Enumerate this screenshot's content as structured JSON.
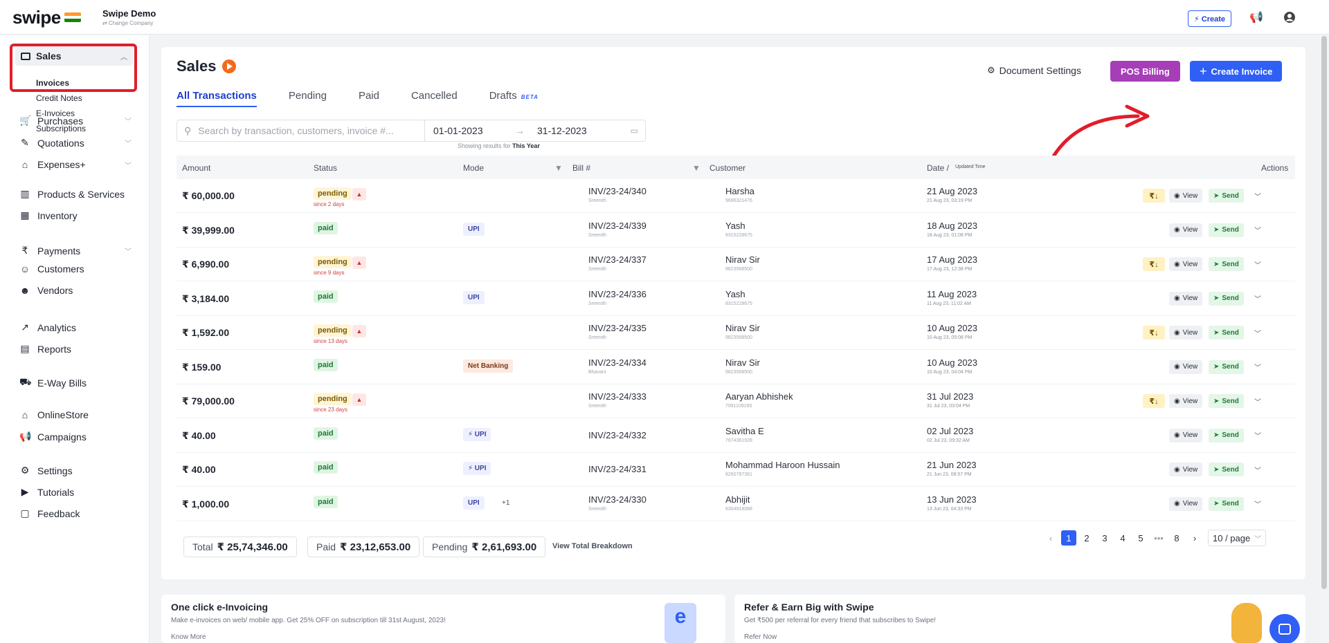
{
  "brand": {
    "logo": "swipe",
    "company_name": "Swipe Demo",
    "change_company": "⇄ Change Company"
  },
  "topbar": {
    "create_label": "⚡ Create"
  },
  "sidebar": {
    "sales_label": "Sales",
    "sales_sub": [
      "Invoices",
      "Credit Notes",
      "E-Invoices",
      "Subscriptions"
    ],
    "items": [
      {
        "label": "Purchases",
        "icon": "cart-icon",
        "chev": true
      },
      {
        "label": "Quotations",
        "icon": "pen-icon",
        "chev": true
      },
      {
        "label": "Expenses+",
        "icon": "tag-icon",
        "chev": true
      },
      {
        "label": "Products & Services",
        "icon": "barcode-icon",
        "chev": false
      },
      {
        "label": "Inventory",
        "icon": "warehouse-icon",
        "chev": false
      },
      {
        "label": "Payments",
        "icon": "rupee-icon",
        "chev": true
      },
      {
        "label": "Customers",
        "icon": "user-icon",
        "chev": false
      },
      {
        "label": "Vendors",
        "icon": "users-icon",
        "chev": false
      },
      {
        "label": "Analytics",
        "icon": "chart-icon",
        "chev": false
      },
      {
        "label": "Reports",
        "icon": "report-icon",
        "chev": false
      },
      {
        "label": "E-Way Bills",
        "icon": "truck-icon",
        "chev": false
      },
      {
        "label": "OnlineStore",
        "icon": "store-icon",
        "chev": false
      },
      {
        "label": "Campaigns",
        "icon": "megaphone-icon",
        "chev": false
      },
      {
        "label": "Settings",
        "icon": "gear-icon",
        "chev": false
      },
      {
        "label": "Tutorials",
        "icon": "youtube-icon",
        "chev": false
      },
      {
        "label": "Feedback",
        "icon": "message-icon",
        "chev": false
      }
    ]
  },
  "main": {
    "title": "Sales",
    "tabs": [
      "All Transactions",
      "Pending",
      "Paid",
      "Cancelled",
      "Drafts"
    ],
    "beta": "BETA",
    "doc_settings": "Document Settings",
    "pos_billing": "POS Billing",
    "create_invoice": "Create Invoice",
    "search_placeholder": "Search by transaction, customers, invoice #...",
    "date_from": "01-01-2023",
    "date_to": "31-12-2023",
    "showing_prefix": "Showing results for",
    "showing_period": "This Year",
    "columns": [
      "Amount",
      "Status",
      "Mode",
      "Bill #",
      "Customer",
      "Date /",
      "Updated Time",
      "Actions"
    ],
    "view_label": "View",
    "send_label": "Send",
    "rupee_down": "₹↓",
    "rows": [
      {
        "amount": "₹ 60,000.00",
        "status": "pending",
        "since": "since 2 days",
        "mode": "",
        "bill": "INV/23-24/340",
        "bill_sub": "Sreenith",
        "customer": "Harsha",
        "cust_sub": "9696321476",
        "date": "21 Aug 2023",
        "date_sub": "21 Aug 23, 03:19 PM"
      },
      {
        "amount": "₹ 39,999.00",
        "status": "paid",
        "since": "",
        "mode": "UPI",
        "bill": "INV/23-24/339",
        "bill_sub": "Sreenith",
        "customer": "Yash",
        "cust_sub": "8315228675",
        "date": "18 Aug 2023",
        "date_sub": "18 Aug 23, 01:08 PM"
      },
      {
        "amount": "₹ 6,990.00",
        "status": "pending",
        "since": "since 9 days",
        "mode": "",
        "bill": "INV/23-24/337",
        "bill_sub": "Sreenith",
        "customer": "Nirav Sir",
        "cust_sub": "9823568500",
        "date": "17 Aug 2023",
        "date_sub": "17 Aug 23, 12:38 PM"
      },
      {
        "amount": "₹ 3,184.00",
        "status": "paid",
        "since": "",
        "mode": "UPI",
        "bill": "INV/23-24/336",
        "bill_sub": "Sreenith",
        "customer": "Yash",
        "cust_sub": "8315228675",
        "date": "11 Aug 2023",
        "date_sub": "11 Aug 23, 11:02 AM"
      },
      {
        "amount": "₹ 1,592.00",
        "status": "pending",
        "since": "since 13 days",
        "mode": "",
        "bill": "INV/23-24/335",
        "bill_sub": "Sreenith",
        "customer": "Nirav Sir",
        "cust_sub": "9823568500",
        "date": "10 Aug 2023",
        "date_sub": "10 Aug 23, 05:08 PM"
      },
      {
        "amount": "₹ 159.00",
        "status": "paid",
        "since": "",
        "mode": "Net Banking",
        "bill": "INV/23-24/334",
        "bill_sub": "Bhavani",
        "customer": "Nirav Sir",
        "cust_sub": "9823568500",
        "date": "10 Aug 2023",
        "date_sub": "10 Aug 23, 04:04 PM"
      },
      {
        "amount": "₹ 79,000.00",
        "status": "pending",
        "since": "since 23 days",
        "mode": "",
        "bill": "INV/23-24/333",
        "bill_sub": "Sreenith",
        "customer": "Aaryan Abhishek",
        "cust_sub": "7091109165",
        "date": "31 Jul 2023",
        "date_sub": "31 Jul 23, 03:04 PM"
      },
      {
        "amount": "₹ 40.00",
        "status": "paid",
        "since": "",
        "mode": "⚡ UPI",
        "bill": "INV/23-24/332",
        "bill_sub": "",
        "customer": "Savitha E",
        "cust_sub": "7674361928",
        "date": "02 Jul 2023",
        "date_sub": "02 Jul 23, 09:32 AM"
      },
      {
        "amount": "₹ 40.00",
        "status": "paid",
        "since": "",
        "mode": "⚡ UPI",
        "bill": "INV/23-24/331",
        "bill_sub": "",
        "customer": "Mohammad Haroon Hussain",
        "cust_sub": "8260787361",
        "date": "21 Jun 2023",
        "date_sub": "21 Jun 23, 08:57 PM"
      },
      {
        "amount": "₹ 1,000.00",
        "status": "paid",
        "since": "",
        "mode": "UPI",
        "mode_extra": "+1",
        "bill": "INV/23-24/330",
        "bill_sub": "Sreenith",
        "customer": "Abhijit",
        "cust_sub": "6304918088",
        "date": "13 Jun 2023",
        "date_sub": "13 Jun 23, 04:33 PM"
      }
    ],
    "totals": {
      "total_label": "Total",
      "total_value": "₹ 25,74,346.00",
      "paid_label": "Paid",
      "paid_value": "₹ 23,12,653.00",
      "pending_label": "Pending",
      "pending_value": "₹ 2,61,693.00",
      "breakdown": "View Total Breakdown"
    },
    "pagination": {
      "pages": [
        "1",
        "2",
        "3",
        "4",
        "5",
        "•••",
        "8"
      ],
      "page_size": "10 / page"
    }
  },
  "promos": [
    {
      "title": "One click e-Invoicing",
      "text": "Make e-invoices on web/ mobile app. Get 25% OFF on subscription till 31st August, 2023!",
      "link": "Know More"
    },
    {
      "title": "Refer & Earn Big with Swipe",
      "text": "Get ₹500 per referral for every friend that subscribes to Swipe!",
      "link": "Refer Now"
    }
  ],
  "colors": {
    "accent": "#2f5ff5",
    "pos": "#a63eb8",
    "highlight": "#e11d2a"
  }
}
